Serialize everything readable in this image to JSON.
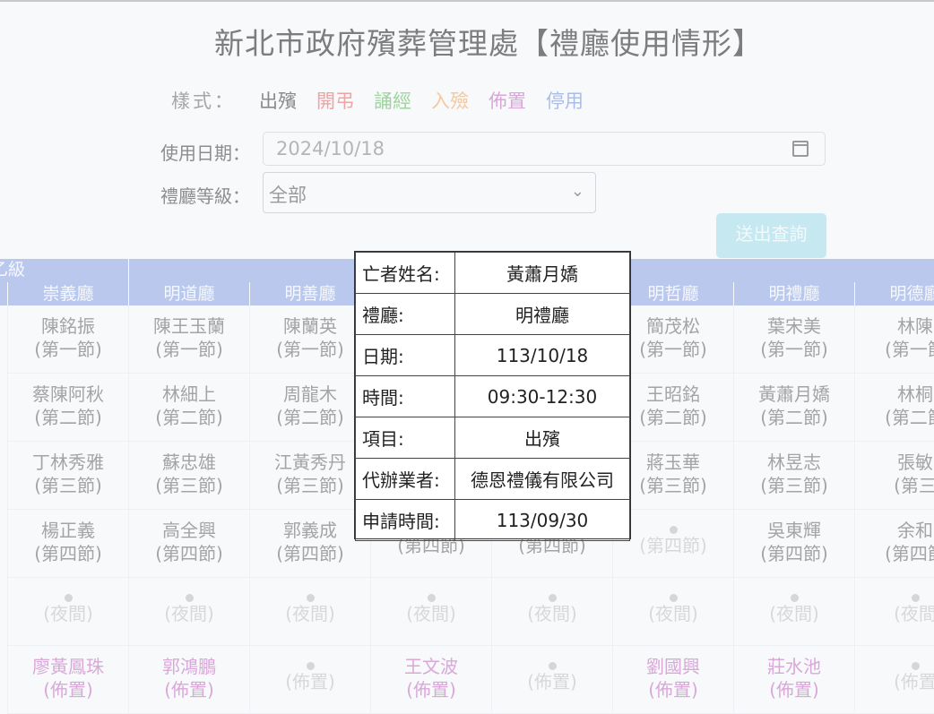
{
  "page": {
    "title": "新北市政府殯葬管理處【禮廳使用情形】"
  },
  "legend": {
    "label": "樣式：",
    "items": [
      {
        "text": "出殯",
        "color": "#8a8a8a"
      },
      {
        "text": "開弔",
        "color": "#f0a3a3"
      },
      {
        "text": "誦經",
        "color": "#9fd49f"
      },
      {
        "text": "入殮",
        "color": "#f3c9a4"
      },
      {
        "text": "佈置",
        "color": "#d7a8d7"
      },
      {
        "text": "停用",
        "color": "#a9bde8"
      }
    ]
  },
  "form": {
    "date_label": "使用日期：",
    "date_value": "2024/10/18",
    "grade_label": "禮廳等級：",
    "grade_value": "全部",
    "submit_label": "送出查詢"
  },
  "table": {
    "group_label": "乙級",
    "halls": [
      "崇義廳",
      "明道廳",
      "明善廳",
      "",
      "",
      "明哲廳",
      "明禮廳",
      "明德廳"
    ],
    "rows": [
      [
        {
          "name": "陳銘振",
          "slot": "(第一節)",
          "style": "chu"
        },
        {
          "name": "陳王玉蘭",
          "slot": "(第一節)",
          "style": "chu"
        },
        {
          "name": "陳蘭英",
          "slot": "(第一節)",
          "style": "chu"
        },
        {
          "name": "",
          "slot": "",
          "style": "chu"
        },
        {
          "name": "",
          "slot": "",
          "style": "chu"
        },
        {
          "name": "簡茂松",
          "slot": "(第一節)",
          "style": "chu"
        },
        {
          "name": "葉宋美",
          "slot": "(第一節)",
          "style": "chu"
        },
        {
          "name": "林陳",
          "slot": "(第一節",
          "style": "chu"
        }
      ],
      [
        {
          "name": "蔡陳阿秋",
          "slot": "(第二節)",
          "style": "chu"
        },
        {
          "name": "林細上",
          "slot": "(第二節)",
          "style": "chu"
        },
        {
          "name": "周龍木",
          "slot": "(第二節)",
          "style": "chu"
        },
        {
          "name": "",
          "slot": "",
          "style": "chu"
        },
        {
          "name": "",
          "slot": "",
          "style": "chu"
        },
        {
          "name": "王昭銘",
          "slot": "(第二節)",
          "style": "chu"
        },
        {
          "name": "黃蕭月嬌",
          "slot": "(第二節)",
          "style": "chu"
        },
        {
          "name": "林桐",
          "slot": "(第二節",
          "style": "chu"
        }
      ],
      [
        {
          "name": "丁林秀雅",
          "slot": "(第三節)",
          "style": "chu"
        },
        {
          "name": "蘇忠雄",
          "slot": "(第三節)",
          "style": "chu"
        },
        {
          "name": "江黃秀丹",
          "slot": "(第三節)",
          "style": "chu"
        },
        {
          "name": "",
          "slot": "",
          "style": "chu"
        },
        {
          "name": "",
          "slot": "",
          "style": "chu"
        },
        {
          "name": "蔣玉華",
          "slot": "(第三節)",
          "style": "chu"
        },
        {
          "name": "林昱志",
          "slot": "(第三節)",
          "style": "chu"
        },
        {
          "name": "張敏",
          "slot": "(第三",
          "style": "chu"
        }
      ],
      [
        {
          "name": "楊正義",
          "slot": "(第四節)",
          "style": "chu"
        },
        {
          "name": "高全興",
          "slot": "(第四節)",
          "style": "chu"
        },
        {
          "name": "郭義成",
          "slot": "(第四節)",
          "style": "chu"
        },
        {
          "name": "",
          "slot": "(第四節)",
          "style": "chu"
        },
        {
          "name": "",
          "slot": "(第四節)",
          "style": "chu"
        },
        {
          "name": "",
          "slot": "(第四節)",
          "style": "dim"
        },
        {
          "name": "吳東輝",
          "slot": "(第四節)",
          "style": "chu"
        },
        {
          "name": "余和",
          "slot": "(第四節",
          "style": "chu"
        }
      ],
      [
        {
          "name": "",
          "slot": "(夜間)",
          "style": "dim"
        },
        {
          "name": "",
          "slot": "(夜間)",
          "style": "dim"
        },
        {
          "name": "",
          "slot": "(夜間)",
          "style": "dim"
        },
        {
          "name": "",
          "slot": "(夜間)",
          "style": "dim"
        },
        {
          "name": "",
          "slot": "(夜間)",
          "style": "dim"
        },
        {
          "name": "",
          "slot": "(夜間)",
          "style": "dim"
        },
        {
          "name": "",
          "slot": "(夜間)",
          "style": "dim"
        },
        {
          "name": "",
          "slot": "(夜間",
          "style": "dim"
        }
      ],
      [
        {
          "name": "廖黃鳳珠",
          "slot": "(佈置)",
          "style": "bu"
        },
        {
          "name": "郭鴻鵬",
          "slot": "(佈置)",
          "style": "bu"
        },
        {
          "name": "",
          "slot": "(佈置)",
          "style": "dim"
        },
        {
          "name": "王文波",
          "slot": "(佈置)",
          "style": "bu"
        },
        {
          "name": "",
          "slot": "(佈置)",
          "style": "dim"
        },
        {
          "name": "劉國興",
          "slot": "(佈置)",
          "style": "bu"
        },
        {
          "name": "莊水池",
          "slot": "(佈置)",
          "style": "bu"
        },
        {
          "name": "",
          "slot": "(佈置",
          "style": "dim"
        }
      ]
    ]
  },
  "popup": {
    "rows": [
      {
        "key": "亡者姓名:",
        "value": "黃蕭月嬌"
      },
      {
        "key": "禮廳:",
        "value": "明禮廳"
      },
      {
        "key": "日期:",
        "value": "113/10/18"
      },
      {
        "key": "時間:",
        "value": "09:30-12:30"
      },
      {
        "key": "項目:",
        "value": "出殯"
      },
      {
        "key": "代辦業者:",
        "value": "德恩禮儀有限公司"
      },
      {
        "key": "申請時間:",
        "value": "113/09/30"
      }
    ]
  }
}
